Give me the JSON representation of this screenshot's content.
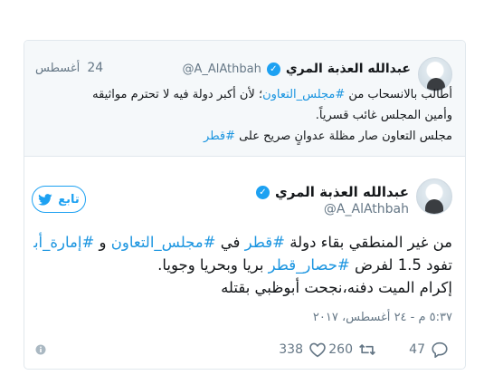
{
  "colors": {
    "accent": "#1da1f2",
    "link": "#1b95e0",
    "muted": "#657786",
    "border": "#e1e8ed"
  },
  "parent_tweet": {
    "name": "عبدالله العذبة المري",
    "handle": "@A_AlAthbah",
    "date_day": "24",
    "date_month": "أغسطس",
    "lines": [
      [
        "أطالب بالانسحاب من ",
        {
          "hashtag": "#مجلس_التعاون"
        },
        "؛ لأن أكبر دولة فيه لا تحترم مواثيقه"
      ],
      [
        "وأمين المجلس غائب قسرياً."
      ],
      [
        "مجلس التعاون صار مظلة عدوانٍ صريح على ",
        {
          "hashtag": "#قطر"
        }
      ]
    ]
  },
  "main_tweet": {
    "name": "عبدالله العذبة المري",
    "handle": "@A_AlAthbah",
    "follow_label": "تابع",
    "line1_a": "من غير المنطقي بقاء دولة ",
    "line1_h1": "#قطر",
    "line1_b": " في ",
    "line1_h2": "#مجلس_التعاون",
    "line1_c": " و ",
    "line1_h3": "#إمارة_أبوظبي",
    "line2_a": "تفود 1.5 لفرض ",
    "line2_h1": "#حصار_قطر",
    "line2_b": " بريا وبحريا وجويا.",
    "line3": "إكرام الميت دفنه،نجحت أبوظبي بقتله",
    "timestamp": "٥:٣٧ م - ٢٤ أغسطس، ٢٠١٧",
    "reply_count": "47",
    "retweet_count": "260",
    "like_count": "338"
  },
  "icons": [
    "verified-badge-icon",
    "twitter-bird-icon",
    "reply-icon",
    "retweet-icon",
    "heart-icon",
    "info-icon"
  ]
}
